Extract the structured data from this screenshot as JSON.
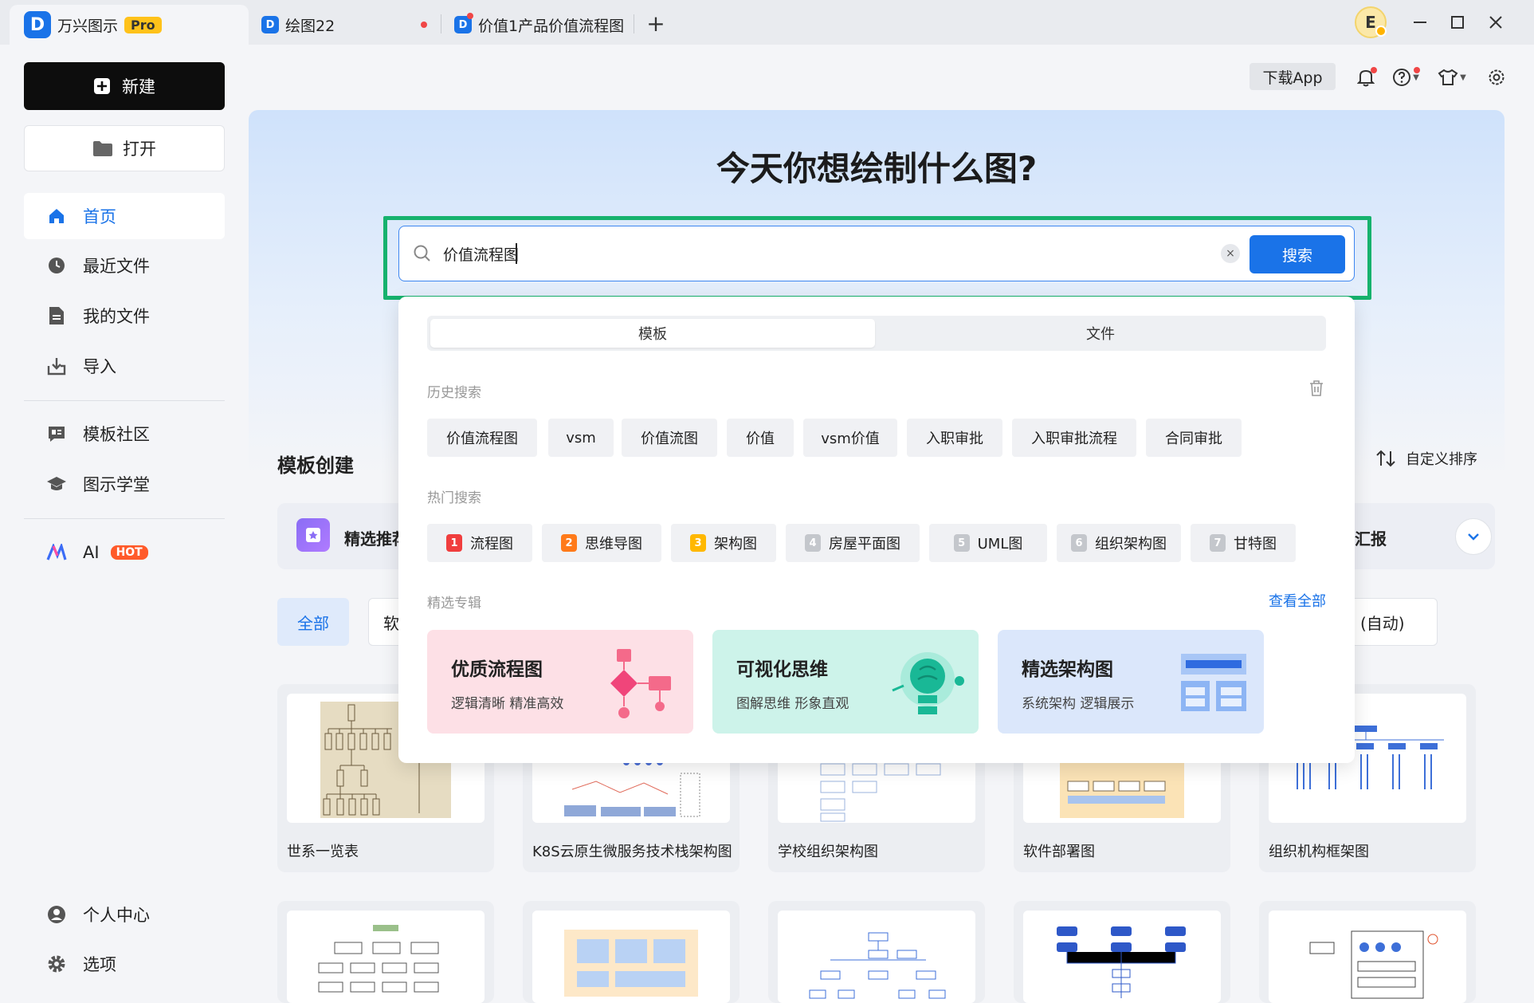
{
  "titlebar": {
    "app_name": "万兴图示",
    "pro_badge": "Pro",
    "logo_letter": "D",
    "tab1": "绘图22",
    "tab2": "价值1产品价值流程图",
    "new_tab": "+",
    "user_initial": "E"
  },
  "sidebar": {
    "new_label": "新建",
    "open_label": "打开",
    "items": [
      {
        "label": "首页"
      },
      {
        "label": "最近文件"
      },
      {
        "label": "我的文件"
      },
      {
        "label": "导入"
      },
      {
        "label": "模板社区"
      },
      {
        "label": "图示学堂"
      },
      {
        "label": "AI"
      }
    ],
    "hot_badge": "HOT",
    "bottom": [
      {
        "label": "个人中心"
      },
      {
        "label": "选项"
      }
    ]
  },
  "topbar": {
    "download_app": "下载App"
  },
  "hero": {
    "title": "今天你想绘制什么图?"
  },
  "search": {
    "value": "价值流程图",
    "button": "搜索",
    "clear": "×"
  },
  "dropdown": {
    "tabs": [
      "模板",
      "文件"
    ],
    "history_label": "历史搜索",
    "history": [
      "价值流程图",
      "vsm",
      "价值流图",
      "价值",
      "vsm价值",
      "入职审批",
      "入职审批流程",
      "合同审批"
    ],
    "hot_label": "热门搜索",
    "hot": [
      {
        "num": "1",
        "label": "流程图",
        "color": "#f03e3e"
      },
      {
        "num": "2",
        "label": "思维导图",
        "color": "#ff7a1a"
      },
      {
        "num": "3",
        "label": "架构图",
        "color": "#ffb800"
      },
      {
        "num": "4",
        "label": "房屋平面图",
        "color": "#c4c7cc"
      },
      {
        "num": "5",
        "label": "UML图",
        "color": "#c4c7cc"
      },
      {
        "num": "6",
        "label": "组织架构图",
        "color": "#c4c7cc"
      },
      {
        "num": "7",
        "label": "甘特图",
        "color": "#c4c7cc"
      }
    ],
    "featured_label": "精选专辑",
    "view_all": "查看全部",
    "featured": [
      {
        "title": "优质流程图",
        "subtitle": "逻辑清晰 精准高效",
        "bg": "#fde0e6"
      },
      {
        "title": "可视化思维",
        "subtitle": "图解思维 形象直观",
        "bg": "#cdf3ea"
      },
      {
        "title": "精选架构图",
        "subtitle": "系统架构 逻辑展示",
        "bg": "#dbe7fb"
      }
    ]
  },
  "templates": {
    "section_title": "模板创建",
    "sort_label": "自定义排序",
    "category_partial": "精选推荐",
    "right_partial": "汇报",
    "filter_all": "全部",
    "filter_partial": "软",
    "auto_partial": "(自动)",
    "cards_row1": [
      {
        "label": "世系一览表"
      },
      {
        "label": "K8S云原生微服务技术栈架构图"
      },
      {
        "label": "学校组织架构图"
      },
      {
        "label": "软件部署图"
      },
      {
        "label": "组织机构框架图"
      }
    ]
  },
  "colors": {
    "accent": "#1a73e8",
    "highlight_frame": "#16b26d"
  }
}
